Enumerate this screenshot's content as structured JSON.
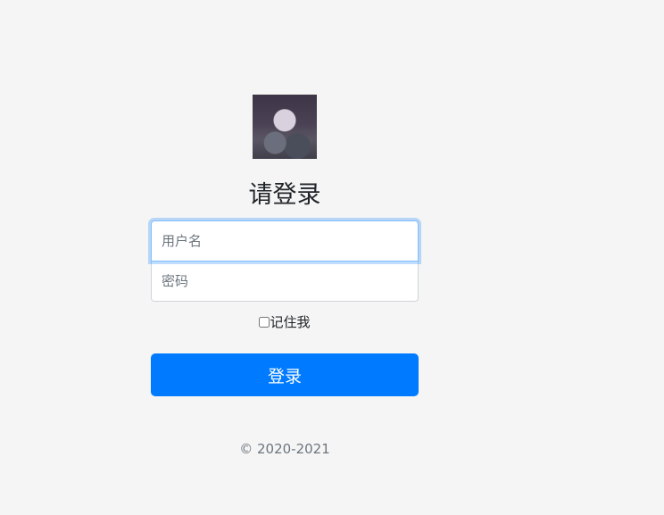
{
  "login": {
    "title": "请登录",
    "username_placeholder": "用户名",
    "password_placeholder": "密码",
    "remember_label": "记住我",
    "submit_label": "登录"
  },
  "footer": {
    "copyright": "© 2020-2021"
  },
  "colors": {
    "background": "#f5f5f5",
    "primary": "#007bff",
    "focus_border": "#80bdff",
    "muted_text": "#6c757d"
  }
}
